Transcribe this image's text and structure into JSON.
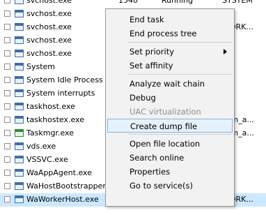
{
  "processes": [
    {
      "name": "svchost.exe",
      "pid": "1540",
      "status": "Running",
      "user": "SYSTEM",
      "icon": "service-host-icon"
    },
    {
      "name": "svchost.exe",
      "pid": "",
      "status": "",
      "user": "",
      "icon": "service-host-icon"
    },
    {
      "name": "svchost.exe",
      "pid": "",
      "status": "",
      "user": "WORK...",
      "icon": "service-host-icon"
    },
    {
      "name": "svchost.exe",
      "pid": "",
      "status": "",
      "user": "",
      "icon": "service-host-icon"
    },
    {
      "name": "svchost.exe",
      "pid": "",
      "status": "",
      "user": "",
      "icon": "service-host-icon"
    },
    {
      "name": "System",
      "pid": "",
      "status": "",
      "user": "",
      "icon": "system-process-icon"
    },
    {
      "name": "System Idle Process",
      "pid": "",
      "status": "",
      "user": "",
      "icon": "system-process-icon"
    },
    {
      "name": "System interrupts",
      "pid": "",
      "status": "",
      "user": "",
      "icon": "system-process-icon"
    },
    {
      "name": "taskhost.exe",
      "pid": "",
      "status": "",
      "user": "",
      "icon": "process-icon"
    },
    {
      "name": "taskhostex.exe",
      "pid": "",
      "status": "",
      "user": "som_a...",
      "icon": "process-icon"
    },
    {
      "name": "Taskmgr.exe",
      "pid": "",
      "status": "",
      "user": "som_a...",
      "icon": "task-manager-icon"
    },
    {
      "name": "vds.exe",
      "pid": "",
      "status": "",
      "user": "",
      "icon": "process-icon"
    },
    {
      "name": "VSSVC.exe",
      "pid": "",
      "status": "",
      "user": "",
      "icon": "process-icon"
    },
    {
      "name": "WaAppAgent.exe",
      "pid": "",
      "status": "",
      "user": "",
      "icon": "process-icon"
    },
    {
      "name": "WaHostBootstrapper.",
      "pid": "",
      "status": "",
      "user": "",
      "icon": "process-icon"
    },
    {
      "name": "WaWorkerHost.exe",
      "pid": "",
      "status": "",
      "user": "WORK...",
      "icon": "process-icon",
      "selected": true
    }
  ],
  "context_menu": {
    "items": [
      {
        "label": "End task",
        "id": "end-task"
      },
      {
        "label": "End process tree",
        "id": "end-process-tree"
      },
      {
        "separator": true
      },
      {
        "label": "Set priority",
        "id": "set-priority",
        "submenu": true
      },
      {
        "label": "Set affinity",
        "id": "set-affinity"
      },
      {
        "separator": true
      },
      {
        "label": "Analyze wait chain",
        "id": "analyze-wait-chain"
      },
      {
        "label": "Debug",
        "id": "debug"
      },
      {
        "label": "UAC virtualization",
        "id": "uac-virtualization",
        "disabled": true
      },
      {
        "label": "Create dump file",
        "id": "create-dump-file",
        "highlighted": true
      },
      {
        "separator": true
      },
      {
        "label": "Open file location",
        "id": "open-file-location"
      },
      {
        "label": "Search online",
        "id": "search-online"
      },
      {
        "label": "Properties",
        "id": "properties"
      },
      {
        "label": "Go to service(s)",
        "id": "go-to-services"
      }
    ]
  },
  "colors": {
    "selected_row": "#cce8ff",
    "menu_background": "#f2f2f2",
    "menu_highlight": "#e5f1fb",
    "menu_highlight_border": "#7eb4ea",
    "disabled_text": "#8d8d8d"
  }
}
